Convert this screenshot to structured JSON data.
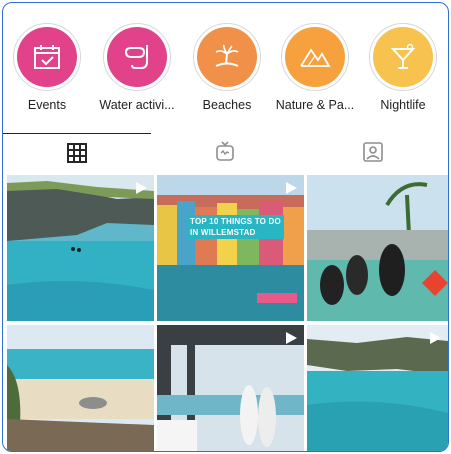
{
  "highlights": [
    {
      "label": "Events",
      "color": "#e1428a",
      "icon": "calendar-icon"
    },
    {
      "label": "Water activi...",
      "color": "#e1428a",
      "icon": "snorkel-mask-icon"
    },
    {
      "label": "Beaches",
      "color": "#f19048",
      "icon": "palm-island-icon"
    },
    {
      "label": "Nature & Pa...",
      "color": "#f6a13e",
      "icon": "mountains-icon"
    },
    {
      "label": "Nightlife",
      "color": "#f7c24e",
      "icon": "cocktail-glass-icon"
    }
  ],
  "tabs": [
    {
      "name": "grid-icon",
      "active": true
    },
    {
      "name": "igtv-icon",
      "active": false
    },
    {
      "name": "tagged-icon",
      "active": false
    }
  ],
  "posts": [
    {
      "scene": "cliff-coast",
      "video": true
    },
    {
      "scene": "willemstad",
      "video": true,
      "caption_line1": "TOP 10 THINGS TO DO",
      "caption_line2": "IN WILLEMSTAD"
    },
    {
      "scene": "divers",
      "video": false
    },
    {
      "scene": "beach",
      "video": false
    },
    {
      "scene": "couple",
      "video": true
    },
    {
      "scene": "rock-bay",
      "video": true
    }
  ]
}
